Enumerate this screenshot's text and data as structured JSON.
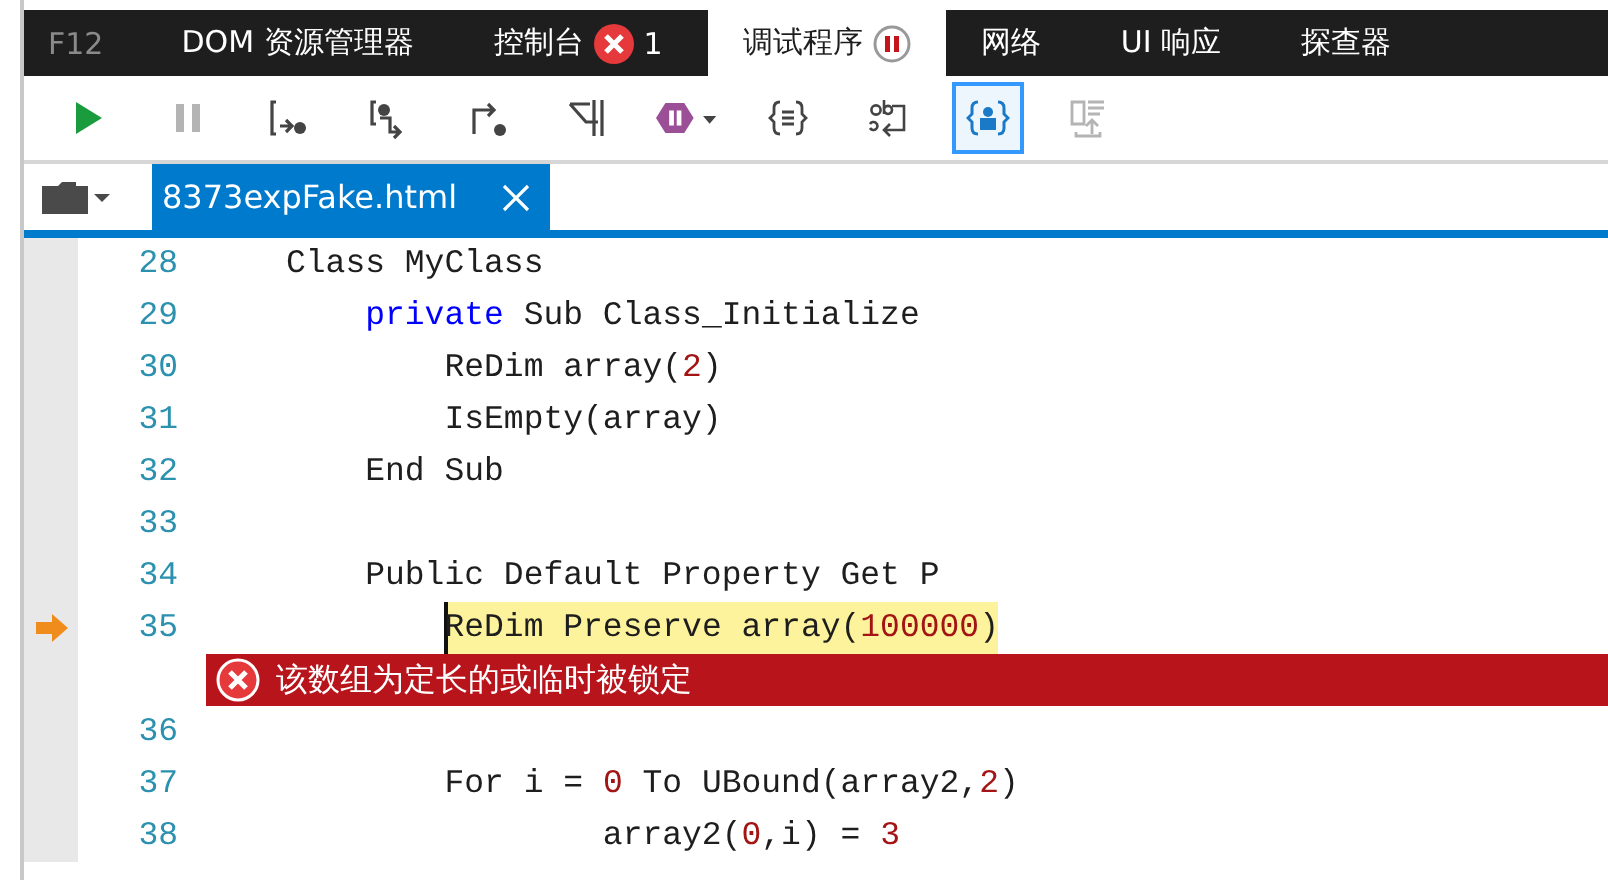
{
  "tool_label": "F12",
  "tabs": [
    {
      "label": "DOM 资源管理器",
      "selected": false
    },
    {
      "label": "控制台",
      "selected": false,
      "badge": {
        "kind": "error",
        "count": "1"
      }
    },
    {
      "label": "调试程序",
      "selected": true,
      "badge": {
        "kind": "paused"
      }
    },
    {
      "label": "网络",
      "selected": false
    },
    {
      "label": "UI 响应",
      "selected": false
    },
    {
      "label": "探查器",
      "selected": false
    }
  ],
  "toolbar": [
    {
      "kind": "continue",
      "disabled": false,
      "selected": false
    },
    {
      "kind": "pause",
      "disabled": true,
      "selected": false
    },
    {
      "kind": "step-into",
      "disabled": false,
      "selected": false
    },
    {
      "kind": "step-over",
      "disabled": false,
      "selected": false
    },
    {
      "kind": "step-out",
      "disabled": false,
      "selected": false
    },
    {
      "kind": "break-new-worker",
      "disabled": false,
      "selected": false
    },
    {
      "kind": "exceptions",
      "disabled": false,
      "selected": false
    },
    {
      "kind": "pretty-print",
      "disabled": false,
      "selected": false
    },
    {
      "kind": "word-wrap",
      "disabled": false,
      "selected": false
    },
    {
      "kind": "just-my-code",
      "disabled": false,
      "selected": true
    },
    {
      "kind": "source-map",
      "disabled": true,
      "selected": false
    }
  ],
  "files": [
    {
      "name": "8373expFake.html",
      "selected": true
    }
  ],
  "code": [
    {
      "kind": "line",
      "number": "28",
      "current": false,
      "tokens": [
        {
          "text": "Class MyClass",
          "kind": "plain"
        }
      ]
    },
    {
      "kind": "line",
      "number": "29",
      "current": false,
      "tokens": [
        {
          "text": "    private",
          "kind": "keyword"
        },
        {
          "text": " Sub Class_Initialize",
          "kind": "plain"
        }
      ]
    },
    {
      "kind": "line",
      "number": "30",
      "current": false,
      "tokens": [
        {
          "text": "        ReDim array(",
          "kind": "plain"
        },
        {
          "text": "2",
          "kind": "number"
        },
        {
          "text": ")",
          "kind": "plain"
        }
      ]
    },
    {
      "kind": "line",
      "number": "31",
      "current": false,
      "tokens": [
        {
          "text": "        IsEmpty(array)",
          "kind": "plain"
        }
      ]
    },
    {
      "kind": "line",
      "number": "32",
      "current": false,
      "tokens": [
        {
          "text": "    End Sub",
          "kind": "plain"
        }
      ]
    },
    {
      "kind": "line",
      "number": "33",
      "current": false
    },
    {
      "kind": "line",
      "number": "34",
      "current": false,
      "tokens": [
        {
          "text": "    Public Default Property Get P",
          "kind": "plain"
        }
      ]
    },
    {
      "kind": "line",
      "number": "35",
      "current": true,
      "tokens": [
        {
          "text": "        ReDim Preserve array(",
          "kind": "plain",
          "highlight": true
        },
        {
          "text": "100000",
          "kind": "number",
          "highlight": true
        },
        {
          "text": ")",
          "kind": "plain",
          "highlight": true
        }
      ]
    },
    {
      "kind": "error",
      "message": "该数组为定长的或临时被锁定"
    },
    {
      "kind": "line",
      "number": "36",
      "current": false
    },
    {
      "kind": "line",
      "number": "37",
      "current": false,
      "tokens": [
        {
          "text": "        For i = ",
          "kind": "plain"
        },
        {
          "text": "0",
          "kind": "number"
        },
        {
          "text": " To UBound(array2,",
          "kind": "plain"
        },
        {
          "text": "2",
          "kind": "number"
        },
        {
          "text": ")",
          "kind": "plain"
        }
      ]
    },
    {
      "kind": "line",
      "number": "38",
      "current": false,
      "tokens": [
        {
          "text": "                array2(",
          "kind": "plain"
        },
        {
          "text": "0",
          "kind": "number"
        },
        {
          "text": ",i) = ",
          "kind": "plain"
        },
        {
          "text": "3",
          "kind": "number"
        }
      ]
    }
  ]
}
